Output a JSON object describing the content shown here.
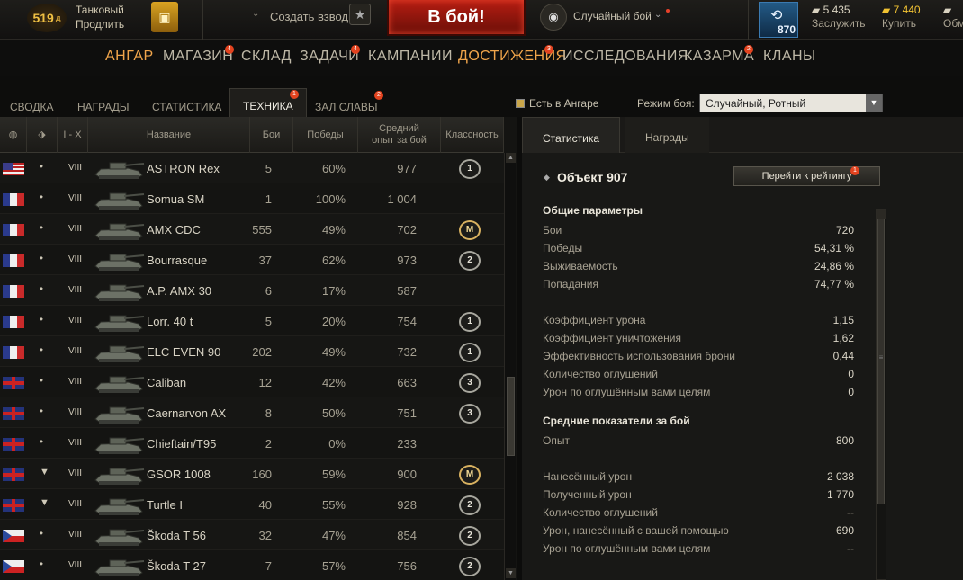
{
  "topbar": {
    "premium_days": "519",
    "premium_unit": "д",
    "premium_title": "Танковый",
    "premium_action": "Продлить",
    "create_squad": "Создать взвод",
    "battle_button": "В бой!",
    "battle_mode": "Случайный бой",
    "bonds_value": "870",
    "silver_value": "5 435",
    "silver_label": "Заслужить",
    "gold_value": "7 440",
    "gold_label": "Купить",
    "free_label": "Обм"
  },
  "nav": {
    "items": [
      {
        "label": "АНГАР",
        "badge": ""
      },
      {
        "label": "МАГАЗИН",
        "badge": "4"
      },
      {
        "label": "СКЛАД",
        "badge": ""
      },
      {
        "label": "ЗАДАЧИ",
        "badge": "4"
      },
      {
        "label": "КАМПАНИИ",
        "badge": ""
      },
      {
        "label": "ДОСТИЖЕНИЯ",
        "badge": "3"
      },
      {
        "label": "ИССЛЕДОВАНИЯ",
        "badge": ""
      },
      {
        "label": "КАЗАРМА",
        "badge": "2"
      },
      {
        "label": "КЛАНЫ",
        "badge": ""
      }
    ]
  },
  "subtabs": {
    "items": [
      "СВОДКА",
      "НАГРАДЫ",
      "СТАТИСТИКА",
      "ТЕХНИКА",
      "ЗАЛ СЛАВЫ"
    ],
    "badges": {
      "tekhnika": "1",
      "zal": "2"
    },
    "in_hangar": "Есть в Ангаре",
    "battle_mode_label": "Режим боя:",
    "battle_mode_value": "Случайный, Ротный"
  },
  "table": {
    "headers": {
      "tier": "I - X",
      "name": "Название",
      "battles": "Бои",
      "wins": "Победы",
      "avg_xp_1": "Средний",
      "avg_xp_2": "опыт за бой",
      "mastery": "Классность"
    },
    "rows": [
      {
        "nation": "us",
        "class": "⬩",
        "tier": "VIII",
        "name": "ASTRON Rex",
        "battles": "5",
        "wins": "60%",
        "xp": "977",
        "mark": "1"
      },
      {
        "nation": "fr",
        "class": "⬩",
        "tier": "VIII",
        "name": "Somua SM",
        "battles": "1",
        "wins": "100%",
        "xp": "1 004",
        "mark": ""
      },
      {
        "nation": "fr",
        "class": "⬩",
        "tier": "VIII",
        "name": "AMX CDC",
        "battles": "555",
        "wins": "49%",
        "xp": "702",
        "mark": "M"
      },
      {
        "nation": "fr",
        "class": "⬩",
        "tier": "VIII",
        "name": "Bourrasque",
        "battles": "37",
        "wins": "62%",
        "xp": "973",
        "mark": "2"
      },
      {
        "nation": "fr",
        "class": "⬩",
        "tier": "VIII",
        "name": "A.P. AMX 30",
        "battles": "6",
        "wins": "17%",
        "xp": "587",
        "mark": ""
      },
      {
        "nation": "fr",
        "class": "⬩",
        "tier": "VIII",
        "name": "Lorr. 40 t",
        "battles": "5",
        "wins": "20%",
        "xp": "754",
        "mark": "1"
      },
      {
        "nation": "fr",
        "class": "⬩",
        "tier": "VIII",
        "name": "ELC EVEN 90",
        "battles": "202",
        "wins": "49%",
        "xp": "732",
        "mark": "1"
      },
      {
        "nation": "gb",
        "class": "⬩",
        "tier": "VIII",
        "name": "Caliban",
        "battles": "12",
        "wins": "42%",
        "xp": "663",
        "mark": "3"
      },
      {
        "nation": "gb",
        "class": "⬩",
        "tier": "VIII",
        "name": "Caernarvon AX",
        "battles": "8",
        "wins": "50%",
        "xp": "751",
        "mark": "3"
      },
      {
        "nation": "gb",
        "class": "⬩",
        "tier": "VIII",
        "name": "Chieftain/T95",
        "battles": "2",
        "wins": "0%",
        "xp": "233",
        "mark": ""
      },
      {
        "nation": "gb",
        "class": "▼",
        "tier": "VIII",
        "name": "GSOR 1008",
        "battles": "160",
        "wins": "59%",
        "xp": "900",
        "mark": "M"
      },
      {
        "nation": "gb",
        "class": "▼",
        "tier": "VIII",
        "name": "Turtle I",
        "battles": "40",
        "wins": "55%",
        "xp": "928",
        "mark": "2"
      },
      {
        "nation": "cz",
        "class": "⬩",
        "tier": "VIII",
        "name": "Škoda T 56",
        "battles": "32",
        "wins": "47%",
        "xp": "854",
        "mark": "2"
      },
      {
        "nation": "cz",
        "class": "⬩",
        "tier": "VIII",
        "name": "Škoda T 27",
        "battles": "7",
        "wins": "57%",
        "xp": "756",
        "mark": "2"
      }
    ]
  },
  "right": {
    "tab_stats": "Статистика",
    "tab_awards": "Награды",
    "vehicle": "Объект 907",
    "rating_button": "Перейти к рейтингу",
    "rating_badge": "1",
    "sec_general": "Общие параметры",
    "general": [
      {
        "label": "Бои",
        "value": "720"
      },
      {
        "label": "Победы",
        "value": "54,31 %"
      },
      {
        "label": "Выживаемость",
        "value": "24,86 %"
      },
      {
        "label": "Попадания",
        "value": "74,77 %"
      }
    ],
    "general2": [
      {
        "label": "Коэффициент урона",
        "value": "1,15"
      },
      {
        "label": "Коэффициент уничтожения",
        "value": "1,62"
      },
      {
        "label": "Эффективность использования брони",
        "value": "0,44"
      },
      {
        "label": "Количество оглушений",
        "value": "0"
      },
      {
        "label": "Урон по оглушённым вами целям",
        "value": "0"
      }
    ],
    "sec_avg": "Средние показатели за бой",
    "avg": [
      {
        "label": "Опыт",
        "value": "800"
      }
    ],
    "avg2": [
      {
        "label": "Нанесённый урон",
        "value": "2 038"
      },
      {
        "label": "Полученный урон",
        "value": "1 770"
      },
      {
        "label": "Количество оглушений",
        "value": "--"
      },
      {
        "label": "Урон, нанесённый с вашей помощью",
        "value": "690"
      },
      {
        "label": "Урон по оглушённым вами целям",
        "value": "--"
      }
    ]
  }
}
